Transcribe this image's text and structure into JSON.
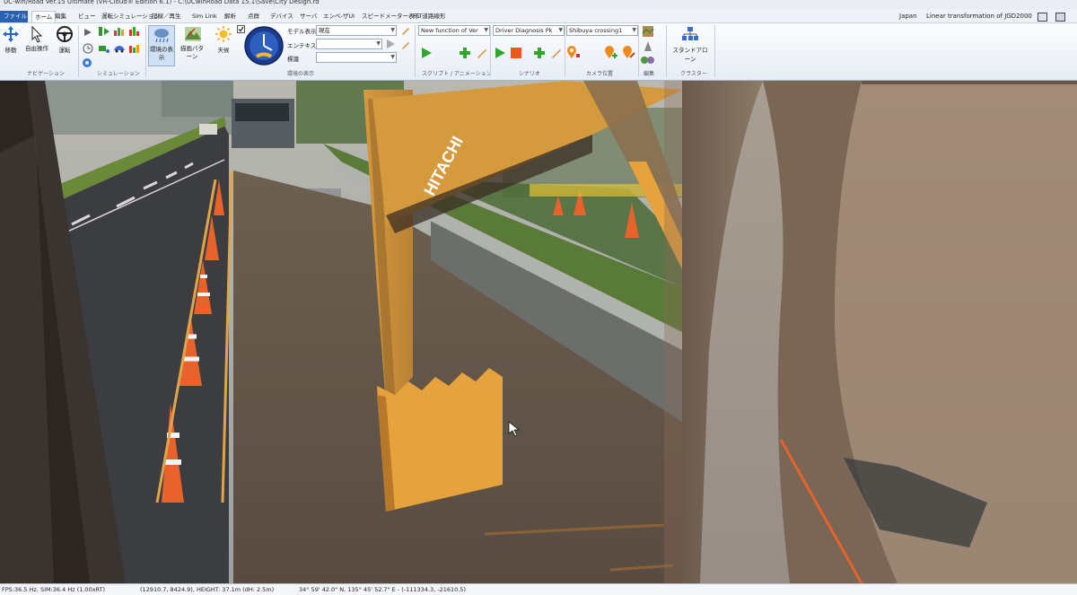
{
  "window": {
    "title": "UC-win/Road Ver.15 Ultimate (VR-Cloud® Edition 6.1) - C:\\UCwinRoad Data 15.1\\Save\\City Design.rd"
  },
  "menu": {
    "file": "ファイル",
    "tabs": [
      "ホーム",
      "編集",
      "ビュー",
      "運転シミュレーション",
      "記録／再生",
      "Sim Link",
      "解析",
      "点群",
      "デバイス",
      "サーバ",
      "エンベ-ザUI",
      "スピードメーター表示",
      "FLT道路線形"
    ],
    "active_tab": "ホーム",
    "region": "Japan",
    "coord_system": "Linear transformation of JGD2000"
  },
  "ribbon": {
    "navigation": {
      "move": "移動",
      "free_op": "自由操作",
      "drive": "運転",
      "group": "ナビゲーション"
    },
    "simulation": {
      "group": "シミュレーション"
    },
    "environment": {
      "env_display": "環境の表示",
      "terrain_pattern": "描画パターン",
      "weather": "天候",
      "model_display_label": "モデル表示",
      "model_display_value": "現在",
      "texture_label": "エンテキスト",
      "texture_value": "",
      "elevation_label": "標識",
      "elevation_value": "",
      "group": "環境の表示"
    },
    "script": {
      "value": "New function of Ver",
      "group": "スクリプト / アニメーション"
    },
    "scenario": {
      "value": "Driver Diagnosis Pk",
      "group": "シナリオ"
    },
    "camera": {
      "value": "Shibuya crossing1",
      "group": "カメラ位置"
    },
    "edit": {
      "group": "編集"
    },
    "cluster": {
      "standalone": "スタンドアローン",
      "group": "クラスター"
    }
  },
  "status": {
    "fps": "FPS:36.5 Hz, SIM:36.4 Hz (1.00xRT)",
    "position": "(12910.7, 8424.9), HEIGHT: 37.1m (dH: 2.5m)",
    "geo": "34° 59' 42.0\" N, 135° 45' 52.7\" E  -  (-111334.3, -21610.5)"
  },
  "scene": {
    "brand": "HITACHI"
  },
  "colors": {
    "accent": "#2b5fb0",
    "ribbon_bg": "#eef2f7",
    "excavator": "#e6a23c",
    "cone_orange": "#e8632c"
  }
}
